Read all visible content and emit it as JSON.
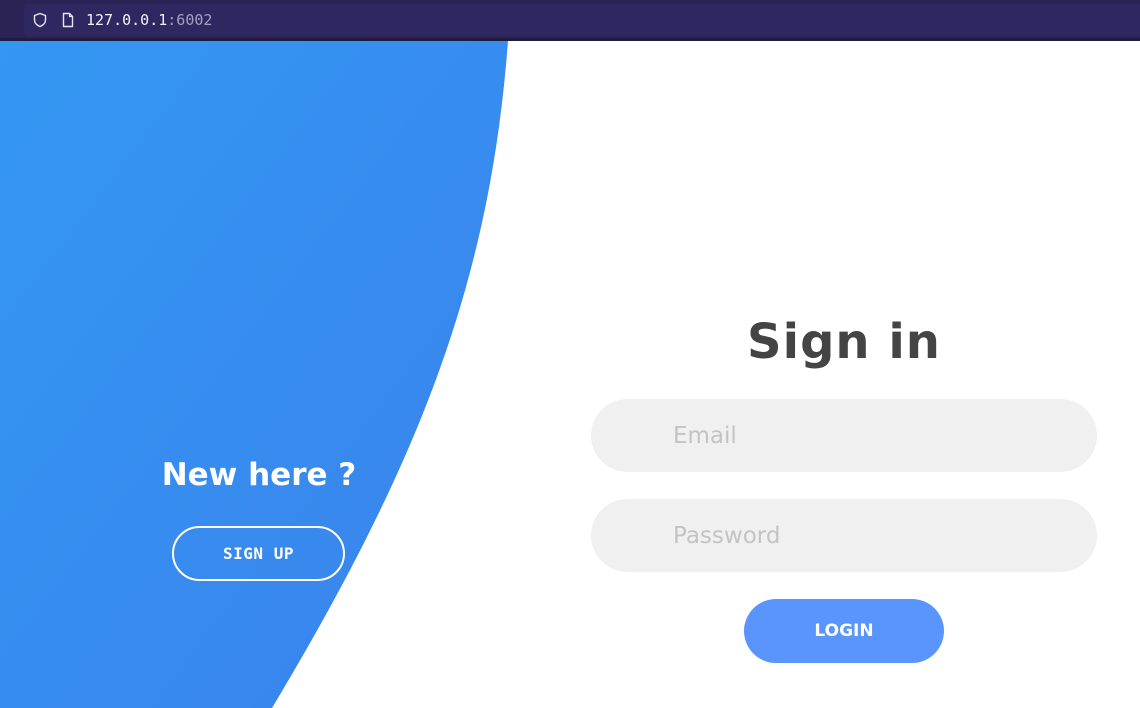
{
  "browser": {
    "url_host": "127.0.0.1",
    "url_port": ":6002"
  },
  "left_panel": {
    "heading": "New here ?",
    "signup_label": "SIGN UP"
  },
  "sign_in_form": {
    "title": "Sign in",
    "email_placeholder": "Email",
    "password_placeholder": "Password",
    "login_label": "LOGIN"
  },
  "icons": {
    "address_bar": [
      "shield-icon",
      "page-icon"
    ]
  },
  "colors": {
    "browser_bar": "#2b2356",
    "panel_gradient_start": "#3497f2",
    "panel_gradient_end": "#3a82ec",
    "input_background": "#f0f0f0",
    "login_button": "#5995fd",
    "title_text": "#444444"
  }
}
